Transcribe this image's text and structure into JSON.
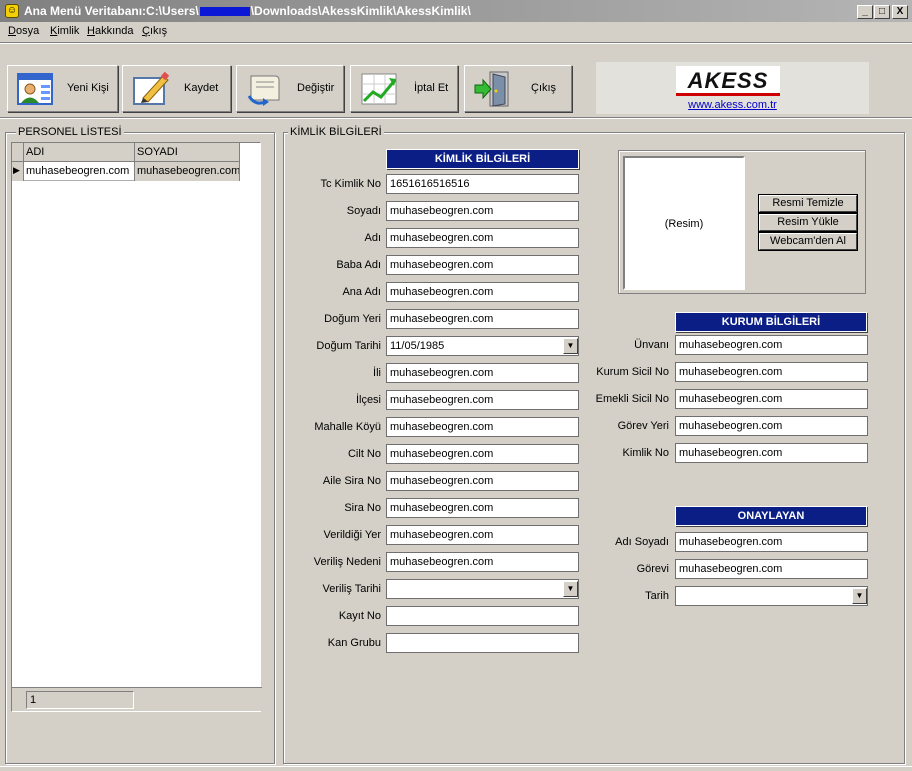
{
  "window": {
    "title_prefix": "Ana Menü Veritabanı:C:\\Users\\",
    "title_suffix": "\\Downloads\\AkessKimlik\\AkessKimlik\\",
    "min_glyph": "_",
    "max_glyph": "□",
    "close_glyph": "X"
  },
  "menu": [
    "Dosya",
    "Kimlik",
    "Hakkında",
    "Çıkış"
  ],
  "toolbar": {
    "new_label": "Yeni Kişi",
    "save_label": "Kaydet",
    "change_label": "Değiştir",
    "cancel_label": "İptal Et",
    "exit_label": "Çıkış"
  },
  "logo": {
    "text": "AKESS",
    "url": "www.akess.com.tr"
  },
  "personnel": {
    "title": "PERSONEL  LİSTESİ",
    "columns": [
      "ADI",
      "SOYADI"
    ],
    "rows": [
      [
        "muhasebeogren.com",
        "muhasebeogren.com"
      ]
    ],
    "row_marker": "▶",
    "count": "1"
  },
  "kimlik": {
    "group_title": "KİMLİK BİLGİLERİ",
    "header": "KİMLİK BİLGİLERİ",
    "fields": [
      {
        "label": "Tc Kimlik No",
        "value": "1651616516516"
      },
      {
        "label": "Soyadı",
        "value": "muhasebeogren.com"
      },
      {
        "label": "Adı",
        "value": "muhasebeogren.com"
      },
      {
        "label": "Baba Adı",
        "value": "muhasebeogren.com"
      },
      {
        "label": "Ana Adı",
        "value": "muhasebeogren.com"
      },
      {
        "label": "Doğum Yeri",
        "value": "muhasebeogren.com"
      },
      {
        "label": "Doğum Tarihi",
        "value": "11/05/1985"
      },
      {
        "label": "İli",
        "value": "muhasebeogren.com"
      },
      {
        "label": "İlçesi",
        "value": "muhasebeogren.com"
      },
      {
        "label": "Mahalle Köyü",
        "value": "muhasebeogren.com"
      },
      {
        "label": "Cilt No",
        "value": "muhasebeogren.com"
      },
      {
        "label": "Aile Sira No",
        "value": "muhasebeogren.com"
      },
      {
        "label": "Sira No",
        "value": "muhasebeogren.com"
      },
      {
        "label": "Verildiği Yer",
        "value": "muhasebeogren.com"
      },
      {
        "label": "Veriliş Nedeni",
        "value": "muhasebeogren.com"
      },
      {
        "label": "Veriliş Tarihi",
        "value": ""
      },
      {
        "label": "Kayıt No",
        "value": ""
      },
      {
        "label": "Kan Grubu",
        "value": ""
      }
    ]
  },
  "photo": {
    "placeholder": "(Resim)",
    "clear_label": "Resmi Temizle",
    "load_label": "Resim Yükle",
    "webcam_label": "Webcam'den Al"
  },
  "kurum": {
    "header": "KURUM BİLGİLERİ",
    "fields": [
      {
        "label": "Ünvanı",
        "value": "muhasebeogren.com"
      },
      {
        "label": "Kurum Sicil No",
        "value": "muhasebeogren.com"
      },
      {
        "label": "Emekli Sicil No",
        "value": "muhasebeogren.com"
      },
      {
        "label": "Görev Yeri",
        "value": "muhasebeogren.com"
      },
      {
        "label": "Kimlik No",
        "value": "muhasebeogren.com"
      }
    ]
  },
  "onaylayan": {
    "header": "ONAYLAYAN",
    "fields": [
      {
        "label": "Adı Soyadı",
        "value": "muhasebeogren.com"
      },
      {
        "label": "Görevi",
        "value": "muhasebeogren.com"
      },
      {
        "label": "Tarih",
        "value": ""
      }
    ]
  },
  "icons": [
    "app-icon",
    "new-person-icon",
    "save-pencil-icon",
    "change-scroll-icon",
    "cancel-chart-icon",
    "exit-door-icon",
    "dropdown-arrow-icon"
  ],
  "colors": {
    "title_bar": "#808080",
    "section_header": "#0a1e86",
    "face": "#d4d0c8",
    "redaction": "#0b18d6"
  }
}
